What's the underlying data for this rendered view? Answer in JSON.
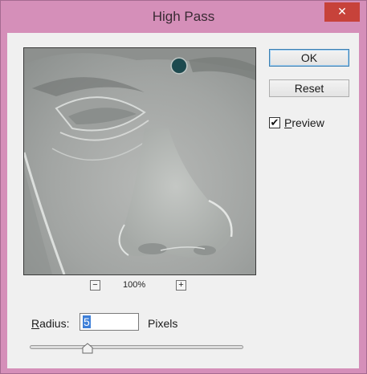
{
  "window": {
    "title": "High Pass",
    "close_glyph": "✕"
  },
  "buttons": {
    "ok": "OK",
    "reset": "Reset"
  },
  "preview_toggle": {
    "label_prefix": "",
    "label_underlined": "P",
    "label_rest": "review",
    "checked": true,
    "check_glyph": "✔"
  },
  "zoom": {
    "level": "100%",
    "minus": "−",
    "plus": "+"
  },
  "radius": {
    "label_underlined": "R",
    "label_rest": "adius:",
    "value": "5",
    "units": "Pixels",
    "slider_fraction": 0.27
  },
  "colors": {
    "accent": "#3d7fd8",
    "close": "#c7423a",
    "frame": "#d58fb9"
  },
  "icons": {
    "close": "close-icon",
    "checkmark": "check-icon",
    "zoom_out": "minus-icon",
    "zoom_in": "plus-icon"
  }
}
